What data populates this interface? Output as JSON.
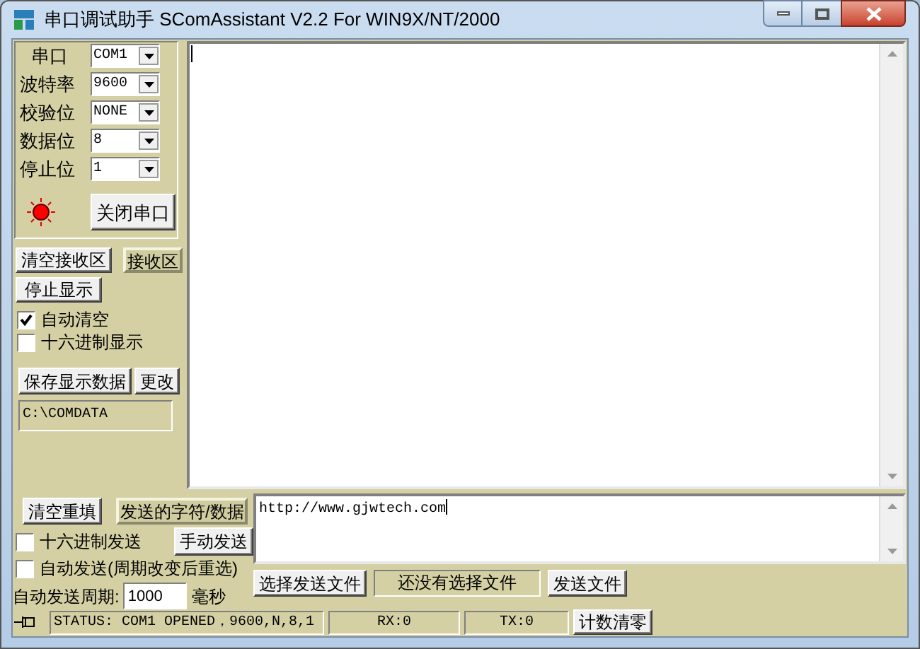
{
  "window": {
    "title": "串口调试助手 SComAssistant V2.2 For WIN9X/NT/2000"
  },
  "port_settings": [
    {
      "label": "串口",
      "value": "COM1"
    },
    {
      "label": "波特率",
      "value": "9600"
    },
    {
      "label": "校验位",
      "value": "NONE"
    },
    {
      "label": "数据位",
      "value": "8"
    },
    {
      "label": "停止位",
      "value": "1"
    }
  ],
  "port_open": true,
  "close_port_button": "关闭串口",
  "receive": {
    "clear_button": "清空接收区",
    "area_label": "接收区",
    "stop_button": "停止显示",
    "options": [
      {
        "label": "自动清空",
        "checked": true
      },
      {
        "label": "十六进制显示",
        "checked": false
      }
    ],
    "save_button": "保存显示数据",
    "change_button": "更改",
    "path": "C:\\COMDATA"
  },
  "send": {
    "clear_button": "清空重填",
    "area_label": "发送的字符/数据",
    "hex_option": {
      "label": "十六进制发送",
      "checked": false
    },
    "manual_button": "手动发送",
    "auto_option": {
      "label": "自动发送(周期改变后重选)",
      "checked": false
    },
    "period_label": "自动发送周期:",
    "period_value": "1000",
    "period_unit": "毫秒",
    "text": "http://www.gjwtech.com",
    "choose_file_button": "选择发送文件",
    "file_status": "还没有选择文件",
    "send_file_button": "发送文件"
  },
  "status_bar": {
    "status": "STATUS: COM1 OPENED，9600,N,8,1",
    "rx": "RX:0",
    "tx": "TX:0",
    "reset_button": "计数清零"
  }
}
